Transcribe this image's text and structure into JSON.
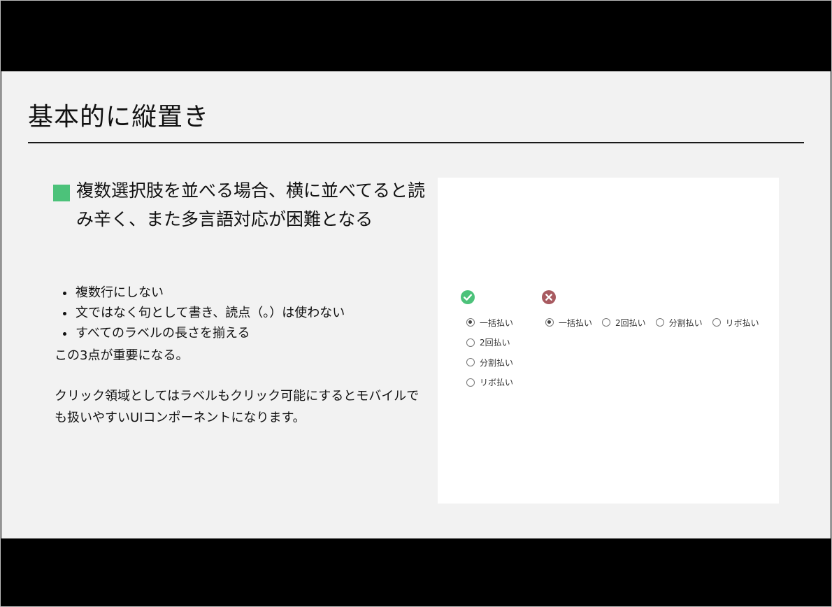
{
  "slide": {
    "title": "基本的に縦置き",
    "accent_color": "#4cc27a",
    "lead": "複数選択肢を並べる場合、横に並べてると読み辛く、また多言語対応が困難となる",
    "points": [
      "複数行にしない",
      "文ではなく句として書き、読点（。）は使わない",
      "すべてのラベルの長さを揃える"
    ],
    "summary": "この3点が重要になる。",
    "note": "クリック領域としてはラベルもクリック可能にするとモバイルでも扱いやすいUIコンポーネントになります。"
  },
  "example": {
    "good_icon": "check-circle-icon",
    "good_color": "#4cc27a",
    "bad_icon": "x-circle-icon",
    "bad_color": "#a85a60",
    "good_options": [
      {
        "label": "一括払い",
        "checked": true
      },
      {
        "label": "2回払い",
        "checked": false
      },
      {
        "label": "分割払い",
        "checked": false
      },
      {
        "label": "リボ払い",
        "checked": false
      }
    ],
    "bad_options": [
      {
        "label": "一括払い",
        "checked": true
      },
      {
        "label": "2回払い",
        "checked": false
      },
      {
        "label": "分割払い",
        "checked": false
      },
      {
        "label": "リボ払い",
        "checked": false
      }
    ]
  }
}
